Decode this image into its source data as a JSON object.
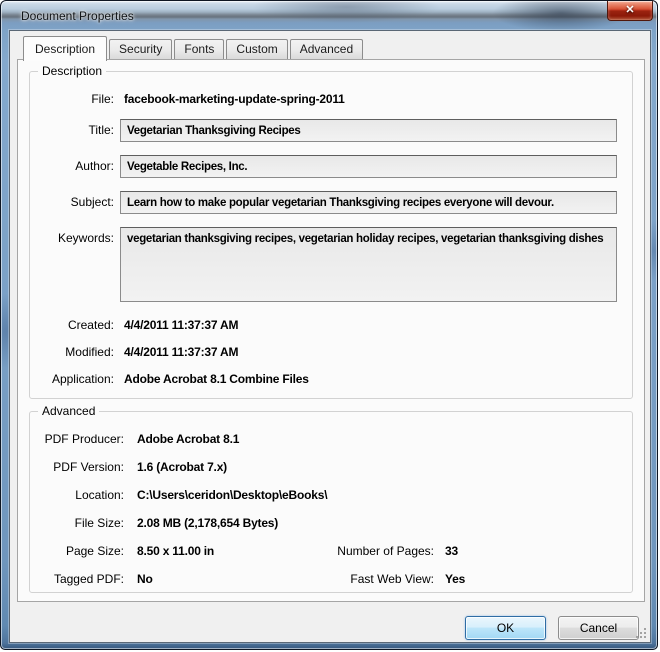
{
  "window": {
    "title": "Document Properties",
    "close_glyph": "✕"
  },
  "tabs": [
    {
      "label": "Description",
      "active": true
    },
    {
      "label": "Security",
      "active": false
    },
    {
      "label": "Fonts",
      "active": false
    },
    {
      "label": "Custom",
      "active": false
    },
    {
      "label": "Advanced",
      "active": false
    }
  ],
  "description": {
    "legend": "Description",
    "file": {
      "label": "File:",
      "value": "facebook-marketing-update-spring-2011"
    },
    "title": {
      "label": "Title:",
      "value": "Vegetarian Thanksgiving Recipes"
    },
    "author": {
      "label": "Author:",
      "value": "Vegetable Recipes, Inc."
    },
    "subject": {
      "label": "Subject:",
      "value": "Learn how to make popular vegetarian Thanksgiving recipes everyone will devour."
    },
    "keywords": {
      "label": "Keywords:",
      "value": "vegetarian thanksgiving recipes, vegetarian holiday recipes, vegetarian thanksgiving dishes"
    },
    "created": {
      "label": "Created:",
      "value": "4/4/2011 11:37:37 AM"
    },
    "modified": {
      "label": "Modified:",
      "value": "4/4/2011 11:37:37 AM"
    },
    "application": {
      "label": "Application:",
      "value": "Adobe Acrobat 8.1 Combine Files"
    }
  },
  "advanced": {
    "legend": "Advanced",
    "pdf_producer": {
      "label": "PDF Producer:",
      "value": "Adobe Acrobat 8.1"
    },
    "pdf_version": {
      "label": "PDF Version:",
      "value": "1.6 (Acrobat 7.x)"
    },
    "location": {
      "label": "Location:",
      "value": "C:\\Users\\ceridon\\Desktop\\eBooks\\"
    },
    "file_size": {
      "label": "File Size:",
      "value": "2.08 MB (2,178,654 Bytes)"
    },
    "page_size": {
      "label": "Page Size:",
      "value": "8.50 x 11.00 in"
    },
    "number_of_pages": {
      "label": "Number of Pages:",
      "value": "33"
    },
    "tagged_pdf": {
      "label": "Tagged PDF:",
      "value": "No"
    },
    "fast_web_view": {
      "label": "Fast Web View:",
      "value": "Yes"
    }
  },
  "buttons": {
    "ok": "OK",
    "cancel": "Cancel"
  },
  "colors": {
    "ok_border": "#2e6da4",
    "close_red": "#c03721",
    "frame_blue": "#7aa0c6",
    "dialog_bg": "#f0f0f0",
    "page_bg": "#fbfbfb"
  }
}
